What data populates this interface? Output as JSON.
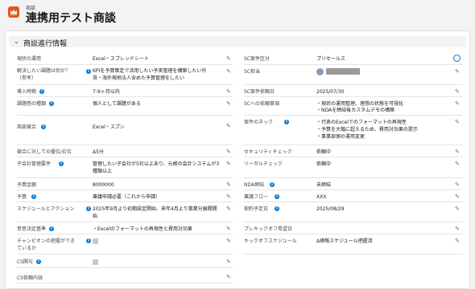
{
  "header": {
    "breadcrumb": "商談",
    "title": "連携用テスト商談"
  },
  "section": {
    "title": "商談進行情報"
  },
  "left": [
    {
      "label": "現状の運用",
      "info": false,
      "value": "Excel・スプレッドシート"
    },
    {
      "label": "解決したい課題は何か？",
      "label2": "（参考）",
      "info": true,
      "value": "KPIを予算策定で活用したい予実管理を構築したい外",
      "value2": "貨・海外現地法人含めた予算管理をしたい"
    },
    {
      "label": "導入時期",
      "info": true,
      "value": "7-9ヶ月以内"
    },
    {
      "label": "課題感の種類",
      "info": true,
      "value": "個人として課題がある"
    },
    {
      "label": "商談競合",
      "info": true,
      "value": "Excel・スプシ"
    },
    {
      "label": "競合に対しての優位/劣位",
      "info": false,
      "value": "Δ5分"
    },
    {
      "label": "子会社管理要件",
      "info": true,
      "value": "管理したい子会社が5社以上あり、元帳の会計システムが3",
      "value2": "種類以上"
    },
    {
      "label": "予算金額",
      "info": false,
      "value": "8000000"
    },
    {
      "label": "予算",
      "info": true,
      "value": "稟議申請必要（これから申請）"
    },
    {
      "label": "スケジュールとアクション",
      "info": true,
      "value": "2025年9月より初期設定開始、来年4月より事業分展開開",
      "value2": "始"
    },
    {
      "label": "意思決定基準",
      "info": true,
      "value": "・Excelのフォーマットの再現性と費用対効果"
    },
    {
      "label": "チャンピオンの把握ができ",
      "label2": "ているか",
      "info": true,
      "value": ""
    },
    {
      "label": "CS関与",
      "info": true,
      "value": ""
    },
    {
      "label": "CS依頼内容",
      "info": false,
      "value": ""
    }
  ],
  "right": [
    {
      "label": "SC案件区分",
      "info": false,
      "value": "プリセールス"
    },
    {
      "label": "SC担当",
      "info": false,
      "value": ""
    },
    {
      "label": "SC案件依頼日",
      "info": false,
      "value": "2025/07/30"
    },
    {
      "label": "SCへの依頼事項",
      "info": false,
      "value": "・現状の運用整理、理想の状態を可視化",
      "value2": "・NDAを締結後カスタムデモの構築"
    },
    {
      "label": "案件のネック",
      "info": true,
      "value": "・代表のExcelでのフォーマットの再現性",
      "value2": "・予算を大幅に超えるため、費用対効果の提示",
      "value3": "・事業部側の運用変更"
    },
    {
      "label": "セキュリティチェック",
      "info": false,
      "value": "依頼中"
    },
    {
      "label": "リーガルチェック",
      "info": false,
      "value": "依頼中"
    },
    {
      "label": "NDA締結",
      "info": true,
      "value": "未締結"
    },
    {
      "label": "稟議フロー",
      "info": true,
      "value": "XXX"
    },
    {
      "label": "契約予定日",
      "info": true,
      "value": "2025/08/29"
    },
    {
      "label": "プレキックオフ希望日",
      "info": false,
      "value": ""
    },
    {
      "label": "キックオフスケジュール",
      "info": false,
      "value": "Δ帳略スケジュール把握済"
    }
  ]
}
